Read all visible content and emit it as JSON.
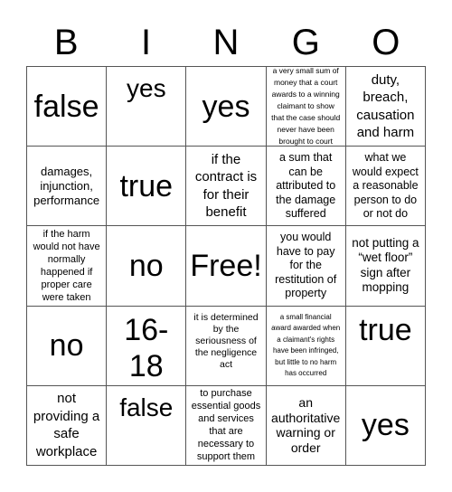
{
  "card": {
    "header": [
      "B",
      "I",
      "N",
      "G",
      "O"
    ],
    "cells": [
      {
        "text": "false"
      },
      {
        "text": "yes"
      },
      {
        "text": "yes"
      },
      {
        "text": "a very small sum of money that a court awards to a winning claimant to show that the case should never have been brought to court"
      },
      {
        "text": "duty, breach, causation and harm"
      },
      {
        "text": "damages, injunction, performance"
      },
      {
        "text": "true"
      },
      {
        "text": "if the contract is for their benefit"
      },
      {
        "text": "a sum that can be attributed to the damage suffered"
      },
      {
        "text": "what we would expect a reasonable person to do or not do"
      },
      {
        "text": "if the harm would not have normally happened if proper care were taken"
      },
      {
        "text": "no"
      },
      {
        "text": "Free!"
      },
      {
        "text": "you would have to pay for the restitution of property"
      },
      {
        "text": "not putting a “wet floor” sign after mopping"
      },
      {
        "text": "no"
      },
      {
        "text": "16-18"
      },
      {
        "text": "it is determined by the seriousness of the negligence act"
      },
      {
        "text": "a small financial award awarded when a claimant's rights have been infringed, but little to no harm has occurred"
      },
      {
        "text": "true"
      },
      {
        "text": "not providing a safe workplace"
      },
      {
        "text": "false"
      },
      {
        "text": "to purchase essential goods and services that are necessary to support them"
      },
      {
        "text": "an authoritative warning or order"
      },
      {
        "text": "yes"
      }
    ]
  }
}
